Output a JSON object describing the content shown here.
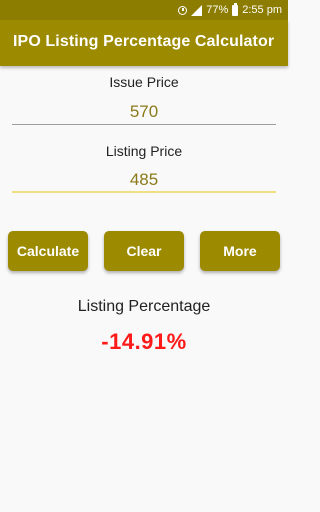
{
  "status_bar": {
    "battery_percent": "77%",
    "time": "2:55 pm",
    "icons": [
      "alarm-icon",
      "signal-icon",
      "battery-icon"
    ]
  },
  "app_bar": {
    "title": "IPO Listing Percentage Calculator"
  },
  "form": {
    "issue_price_label": "Issue Price",
    "issue_price_value": "570",
    "listing_price_label": "Listing Price",
    "listing_price_value": "485"
  },
  "buttons": {
    "calculate": "Calculate",
    "clear": "Clear",
    "more": "More"
  },
  "result": {
    "label": "Listing Percentage",
    "value": "-14.91%"
  },
  "colors": {
    "primary": "#9c8a00",
    "status_bar": "#8c7d00",
    "input_text": "#8a7a1a",
    "result_negative": "#ff1a1a"
  }
}
